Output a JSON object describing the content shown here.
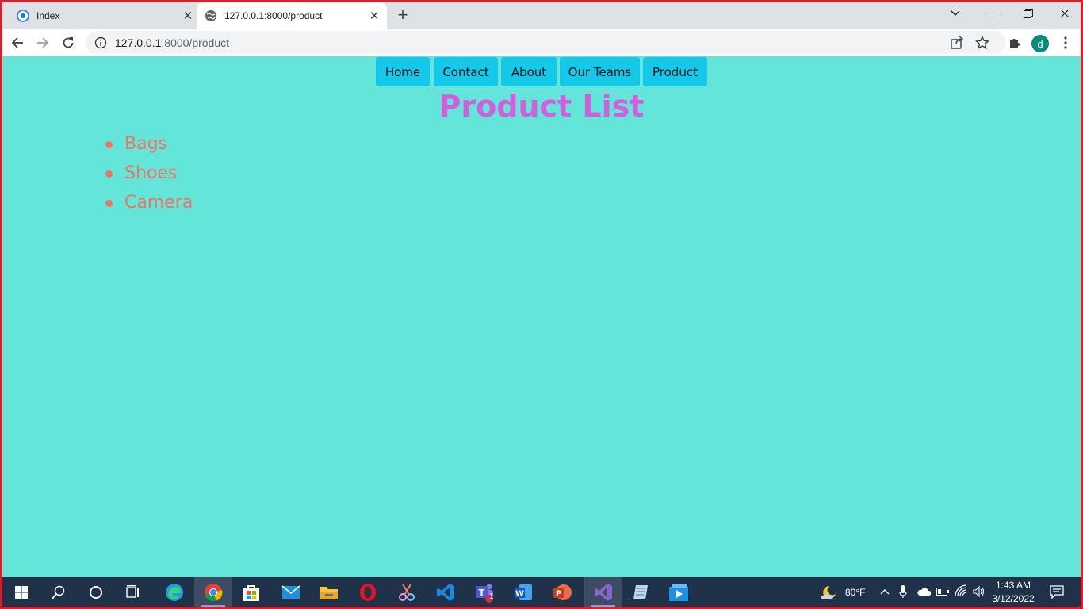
{
  "browser": {
    "tabs": [
      {
        "title": "Index",
        "favicon": "app-icon"
      },
      {
        "title": "127.0.0.1:8000/product",
        "favicon": "globe-icon"
      }
    ],
    "window_controls": [
      "chevron-down-icon",
      "minimize-icon",
      "restore-icon",
      "close-icon"
    ],
    "address": {
      "host": "127.0.0.1",
      "rest": ":8000/product"
    },
    "profile_initial": "d"
  },
  "page": {
    "background": "#64e5d9",
    "nav": [
      {
        "label": "Home"
      },
      {
        "label": "Contact"
      },
      {
        "label": "About"
      },
      {
        "label": "Our Teams"
      },
      {
        "label": "Product"
      }
    ],
    "heading": "Product List",
    "products": [
      {
        "name": "Bags"
      },
      {
        "name": "Shoes"
      },
      {
        "name": "Camera"
      }
    ],
    "colors": {
      "nav_button": "#14c8ea",
      "heading": "#d35fdc",
      "list_text": "#f07462"
    }
  },
  "taskbar": {
    "weather": "80°F",
    "time": "1:43 AM",
    "date": "3/12/2022",
    "teams_badge": "1",
    "apps": [
      "start-icon",
      "search-icon",
      "cortana-icon",
      "task-view-icon",
      "edge-icon",
      "chrome-icon",
      "store-icon",
      "mail-icon",
      "file-explorer-icon",
      "opera-icon",
      "snip-icon",
      "vscode-icon",
      "teams-icon",
      "word-icon",
      "powerpoint-icon",
      "visual-studio-icon",
      "notepad-icon",
      "video-editor-icon"
    ]
  }
}
